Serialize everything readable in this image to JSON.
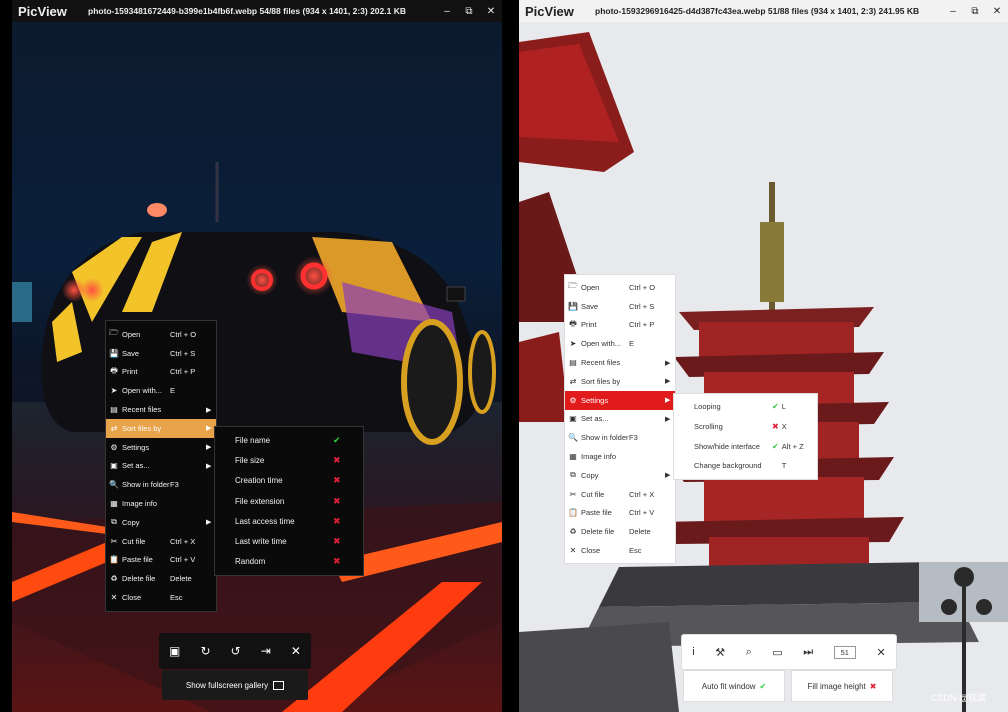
{
  "left_window": {
    "logo": "PicView",
    "title": "photo-1593481672449-b399e1b4fb6f.webp 54/88 files (934 x 1401, 2:3) 202.1 KB",
    "controls": [
      "‒",
      "⧉",
      "✕"
    ],
    "menu": [
      {
        "icon": "open",
        "label": "Open",
        "shortcut": "Ctrl + O",
        "arrow": ""
      },
      {
        "icon": "save",
        "label": "Save",
        "shortcut": "Ctrl + S",
        "arrow": ""
      },
      {
        "icon": "print",
        "label": "Print",
        "shortcut": "Ctrl + P",
        "arrow": ""
      },
      {
        "icon": "open-with",
        "label": "Open with...",
        "shortcut": "E",
        "arrow": ""
      },
      {
        "icon": "recent",
        "label": "Recent files",
        "shortcut": "",
        "arrow": "▶"
      },
      {
        "icon": "sort",
        "label": "Sort files by",
        "shortcut": "",
        "arrow": "▶",
        "highlighted": true
      },
      {
        "icon": "settings",
        "label": "Settings",
        "shortcut": "",
        "arrow": "▶"
      },
      {
        "icon": "set-as",
        "label": "Set as...",
        "shortcut": "",
        "arrow": "▶"
      },
      {
        "icon": "folder",
        "label": "Show in folder",
        "shortcut": "F3",
        "arrow": ""
      },
      {
        "icon": "info",
        "label": "Image info",
        "shortcut": "",
        "arrow": ""
      },
      {
        "icon": "copy",
        "label": "Copy",
        "shortcut": "",
        "arrow": "▶"
      },
      {
        "icon": "cut",
        "label": "Cut file",
        "shortcut": "Ctrl + X",
        "arrow": ""
      },
      {
        "icon": "paste",
        "label": "Paste file",
        "shortcut": "Ctrl + V",
        "arrow": ""
      },
      {
        "icon": "delete",
        "label": "Delete file",
        "shortcut": "Delete",
        "arrow": ""
      },
      {
        "icon": "close",
        "label": "Close",
        "shortcut": "Esc",
        "arrow": ""
      }
    ],
    "submenu": [
      {
        "label": "File name",
        "mark": "✔",
        "state": "on"
      },
      {
        "label": "File size",
        "mark": "✖",
        "state": "off"
      },
      {
        "label": "Creation time",
        "mark": "✖",
        "state": "off"
      },
      {
        "label": "File extension",
        "mark": "✖",
        "state": "off"
      },
      {
        "label": "Last access time",
        "mark": "✖",
        "state": "off"
      },
      {
        "label": "Last write time",
        "mark": "✖",
        "state": "off"
      },
      {
        "label": "Random",
        "mark": "✖",
        "state": "off"
      }
    ],
    "toolbar": [
      "▣",
      "↻",
      "↺",
      "⇥",
      "✕"
    ],
    "gallery_button": "Show fullscreen gallery"
  },
  "right_window": {
    "logo": "PicView",
    "title": "photo-1593296916425-d4d387fc43ea.webp 51/88 files (934 x 1401, 2:3) 241.95 KB",
    "controls": [
      "‒",
      "⧉",
      "✕"
    ],
    "menu": [
      {
        "icon": "open",
        "label": "Open",
        "shortcut": "Ctrl + O",
        "arrow": ""
      },
      {
        "icon": "save",
        "label": "Save",
        "shortcut": "Ctrl + S",
        "arrow": ""
      },
      {
        "icon": "print",
        "label": "Print",
        "shortcut": "Ctrl + P",
        "arrow": ""
      },
      {
        "icon": "open-with",
        "label": "Open with...",
        "shortcut": "E",
        "arrow": ""
      },
      {
        "icon": "recent",
        "label": "Recent files",
        "shortcut": "",
        "arrow": "▶"
      },
      {
        "icon": "sort",
        "label": "Sort files by",
        "shortcut": "",
        "arrow": "▶"
      },
      {
        "icon": "settings",
        "label": "Settings",
        "shortcut": "",
        "arrow": "▶",
        "highlighted": true
      },
      {
        "icon": "set-as",
        "label": "Set as...",
        "shortcut": "",
        "arrow": "▶"
      },
      {
        "icon": "folder",
        "label": "Show in folder",
        "shortcut": "F3",
        "arrow": ""
      },
      {
        "icon": "info",
        "label": "Image info",
        "shortcut": "",
        "arrow": ""
      },
      {
        "icon": "copy",
        "label": "Copy",
        "shortcut": "",
        "arrow": "▶"
      },
      {
        "icon": "cut",
        "label": "Cut file",
        "shortcut": "Ctrl + X",
        "arrow": ""
      },
      {
        "icon": "paste",
        "label": "Paste file",
        "shortcut": "Ctrl + V",
        "arrow": ""
      },
      {
        "icon": "delete",
        "label": "Delete file",
        "shortcut": "Delete",
        "arrow": ""
      },
      {
        "icon": "close",
        "label": "Close",
        "shortcut": "Esc",
        "arrow": ""
      }
    ],
    "submenu": [
      {
        "label": "Looping",
        "mark": "✔",
        "state": "on",
        "shortcut": "L"
      },
      {
        "label": "Scrolling",
        "mark": "✖",
        "state": "off",
        "shortcut": "X"
      },
      {
        "label": "Show/hide interface",
        "mark": "✔",
        "state": "on",
        "shortcut": "Alt + Z"
      },
      {
        "label": "Change background",
        "mark": "",
        "state": "",
        "shortcut": "T"
      }
    ],
    "toolbar": [
      "i",
      "⚒",
      "⌕",
      "▭",
      "⏭"
    ],
    "page_number": "51",
    "toolbar_close": "✕",
    "auto_fit": "Auto fit window",
    "fill_height": "Fill image height"
  },
  "watermark": "CSDN @铭瑜",
  "colors": {
    "dark_highlight": "#e8a24a",
    "light_highlight": "#e11b1b",
    "check_green": "#2ecc40",
    "cross_red": "#e0213a"
  }
}
